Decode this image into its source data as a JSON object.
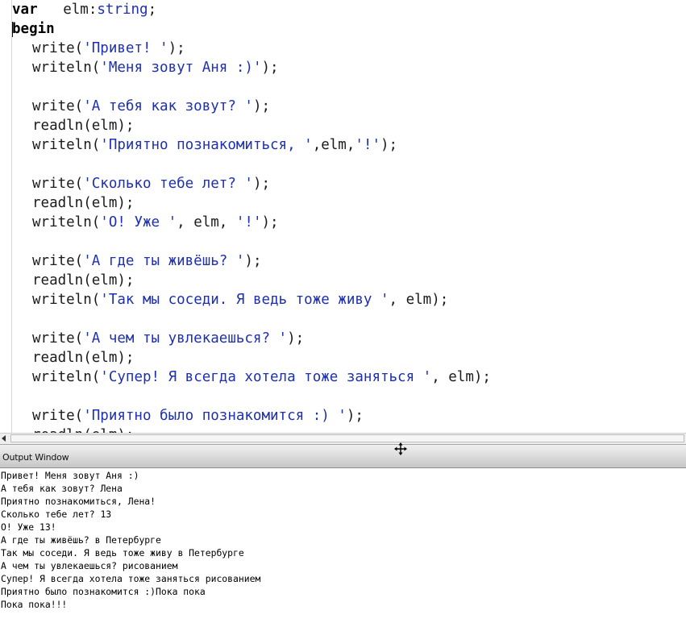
{
  "editor": {
    "lines": [
      {
        "indent": false,
        "caret": false,
        "segments": [
          {
            "t": "kw",
            "v": "var"
          },
          {
            "t": "txt",
            "v": "   elm:"
          },
          {
            "t": "ty",
            "v": "string"
          },
          {
            "t": "txt",
            "v": ";"
          }
        ]
      },
      {
        "indent": false,
        "caret": true,
        "segments": [
          {
            "t": "kw",
            "v": "begin"
          }
        ]
      },
      {
        "indent": true,
        "caret": false,
        "segments": [
          {
            "t": "txt",
            "v": "write("
          },
          {
            "t": "str",
            "v": "'Привет! '"
          },
          {
            "t": "txt",
            "v": ");"
          }
        ]
      },
      {
        "indent": true,
        "caret": false,
        "segments": [
          {
            "t": "txt",
            "v": "writeln("
          },
          {
            "t": "str",
            "v": "'Меня зовут Аня :)'"
          },
          {
            "t": "txt",
            "v": ");"
          }
        ]
      },
      {
        "indent": true,
        "caret": false,
        "segments": []
      },
      {
        "indent": true,
        "caret": false,
        "segments": [
          {
            "t": "txt",
            "v": "write("
          },
          {
            "t": "str",
            "v": "'А тебя как зовут? '"
          },
          {
            "t": "txt",
            "v": ");"
          }
        ]
      },
      {
        "indent": true,
        "caret": false,
        "segments": [
          {
            "t": "txt",
            "v": "readln(elm);"
          }
        ]
      },
      {
        "indent": true,
        "caret": false,
        "segments": [
          {
            "t": "txt",
            "v": "writeln("
          },
          {
            "t": "str",
            "v": "'Приятно познакомиться, '"
          },
          {
            "t": "txt",
            "v": ",elm,"
          },
          {
            "t": "str",
            "v": "'!'"
          },
          {
            "t": "txt",
            "v": ");"
          }
        ]
      },
      {
        "indent": true,
        "caret": false,
        "segments": []
      },
      {
        "indent": true,
        "caret": false,
        "segments": [
          {
            "t": "txt",
            "v": "write("
          },
          {
            "t": "str",
            "v": "'Сколько тебе лет? '"
          },
          {
            "t": "txt",
            "v": ");"
          }
        ]
      },
      {
        "indent": true,
        "caret": false,
        "segments": [
          {
            "t": "txt",
            "v": "readln(elm);"
          }
        ]
      },
      {
        "indent": true,
        "caret": false,
        "segments": [
          {
            "t": "txt",
            "v": "writeln("
          },
          {
            "t": "str",
            "v": "'О! Уже '"
          },
          {
            "t": "txt",
            "v": ", elm, "
          },
          {
            "t": "str",
            "v": "'!'"
          },
          {
            "t": "txt",
            "v": ");"
          }
        ]
      },
      {
        "indent": true,
        "caret": false,
        "segments": []
      },
      {
        "indent": true,
        "caret": false,
        "segments": [
          {
            "t": "txt",
            "v": "write("
          },
          {
            "t": "str",
            "v": "'А где ты живёшь? '"
          },
          {
            "t": "txt",
            "v": ");"
          }
        ]
      },
      {
        "indent": true,
        "caret": false,
        "segments": [
          {
            "t": "txt",
            "v": "readln(elm);"
          }
        ]
      },
      {
        "indent": true,
        "caret": false,
        "segments": [
          {
            "t": "txt",
            "v": "writeln("
          },
          {
            "t": "str",
            "v": "'Так мы соседи. Я ведь тоже живу '"
          },
          {
            "t": "txt",
            "v": ", elm);"
          }
        ]
      },
      {
        "indent": true,
        "caret": false,
        "segments": []
      },
      {
        "indent": true,
        "caret": false,
        "segments": [
          {
            "t": "txt",
            "v": "write("
          },
          {
            "t": "str",
            "v": "'А чем ты увлекаешься? '"
          },
          {
            "t": "txt",
            "v": ");"
          }
        ]
      },
      {
        "indent": true,
        "caret": false,
        "segments": [
          {
            "t": "txt",
            "v": "readln(elm);"
          }
        ]
      },
      {
        "indent": true,
        "caret": false,
        "segments": [
          {
            "t": "txt",
            "v": "writeln("
          },
          {
            "t": "str",
            "v": "'Супер! Я всегда хотела тоже заняться '"
          },
          {
            "t": "txt",
            "v": ", elm);"
          }
        ]
      },
      {
        "indent": true,
        "caret": false,
        "segments": []
      },
      {
        "indent": true,
        "caret": false,
        "segments": [
          {
            "t": "txt",
            "v": "write("
          },
          {
            "t": "str",
            "v": "'Приятно было познакомится :) '"
          },
          {
            "t": "txt",
            "v": ");"
          }
        ]
      },
      {
        "indent": true,
        "caret": false,
        "segments": [
          {
            "t": "txt",
            "v": "readln(elm);"
          }
        ]
      }
    ]
  },
  "output_window": {
    "title": "Output Window",
    "lines": [
      "Привет! Меня зовут Аня :)",
      "А тебя как зовут? Лена",
      "Приятно познакомиться, Лена!",
      "Сколько тебе лет? 13",
      "О! Уже 13!",
      "А где ты живёшь? в Петербурге",
      "Так мы соседи. Я ведь тоже живу в Петербурге",
      "А чем ты увлекаешься? рисованием",
      "Супер! Я всегда хотела тоже заняться рисованием",
      "Приятно было познакомится :)Пока пока",
      "Пока пока!!!"
    ]
  },
  "icons": {
    "scroll_left": "arrow-left-icon",
    "splitter": "move-icon"
  }
}
